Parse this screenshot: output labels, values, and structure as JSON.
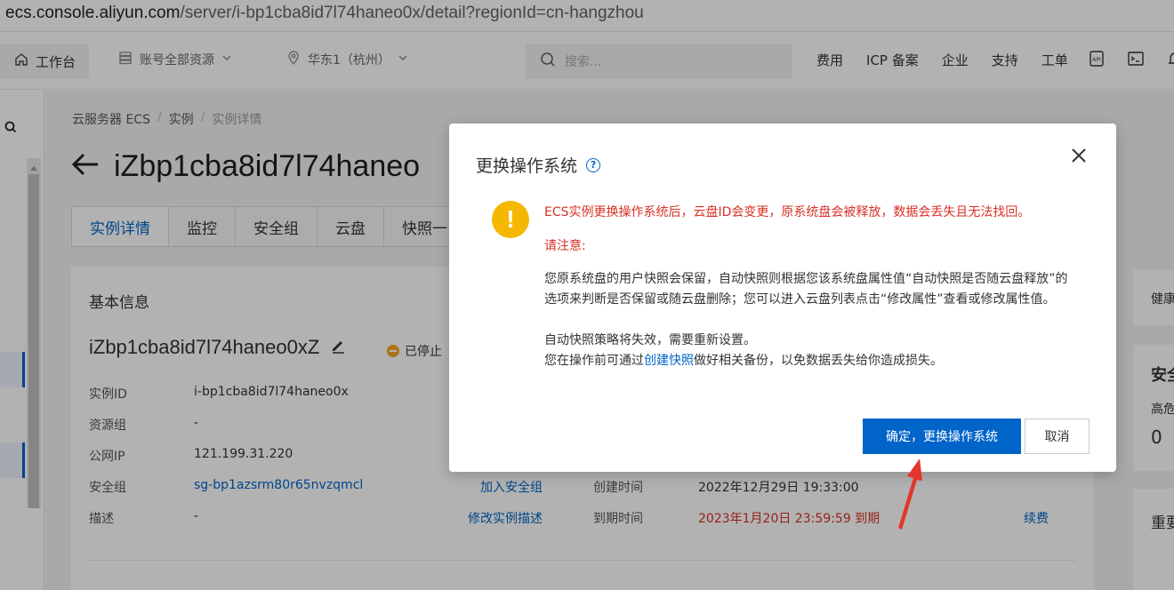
{
  "browser": {
    "url_host": "ecs.console.aliyun.com",
    "url_path": "/server/i-bp1cba8id7l74haneo0x/detail?regionId=cn-hangzhou"
  },
  "topnav": {
    "home_label": "工作台",
    "resources_label": "账号全部资源",
    "region_label": "华东1（杭州）",
    "search_placeholder": "搜索...",
    "links": [
      "费用",
      "ICP 备案",
      "企业",
      "支持",
      "工单"
    ]
  },
  "breadcrumb": [
    "云服务器 ECS",
    "实例",
    "实例详情"
  ],
  "page_title": "iZbp1cba8id7l74haneo",
  "tabs": [
    "实例详情",
    "监控",
    "安全组",
    "云盘",
    "快照一"
  ],
  "basic_info": {
    "heading": "基本信息",
    "instance_name": "iZbp1cba8id7l74haneo0xZ",
    "status": "已停止",
    "rows": [
      {
        "key": "实例ID",
        "value": "i-bp1cba8id7l74haneo0x"
      },
      {
        "key": "资源组",
        "value": "-"
      },
      {
        "key": "公网IP",
        "value": "121.199.31.220"
      },
      {
        "key": "安全组",
        "value": "sg-bp1azsrm80r65nvzqmcl"
      },
      {
        "key": "描述",
        "value": "-"
      }
    ],
    "join_sg": "加入安全组",
    "edit_desc": "修改实例描述",
    "created_label": "创建时间",
    "created_value": "2022年12月29日 19:33:00",
    "expire_label": "到期时间",
    "expire_value": "2023年1月20日 23:59:59 到期",
    "renew": "续费"
  },
  "right_panel": {
    "health": "健康",
    "security": "安全",
    "risk": "高危",
    "risk_count": "0",
    "important": "重要"
  },
  "dialog": {
    "title": "更换操作系统",
    "warning": "ECS实例更换操作系统后，云盘ID会变更，原系统盘会被释放，数据会丢失且无法找回。",
    "notice_heading": "请注意:",
    "para1": "您原系统盘的用户快照会保留，自动快照则根据您该系统盘属性值“自动快照是否随云盘释放”的选项来判断是否保留或随云盘删除；您可以进入云盘列表点击“修改属性”查看或修改属性值。",
    "para2": "自动快照策略将失效，需要重新设置。",
    "para3_prefix": "您在操作前可通过",
    "para3_link": "创建快照",
    "para3_suffix": "做好相关备份，以免数据丢失给你造成损失。",
    "confirm_label": "确定，更换操作系统",
    "cancel_label": "取消"
  },
  "colors": {
    "primary": "#0064c8",
    "danger": "#d93026",
    "warning": "#f5b800",
    "annotation_arrow": "#e5352b"
  }
}
